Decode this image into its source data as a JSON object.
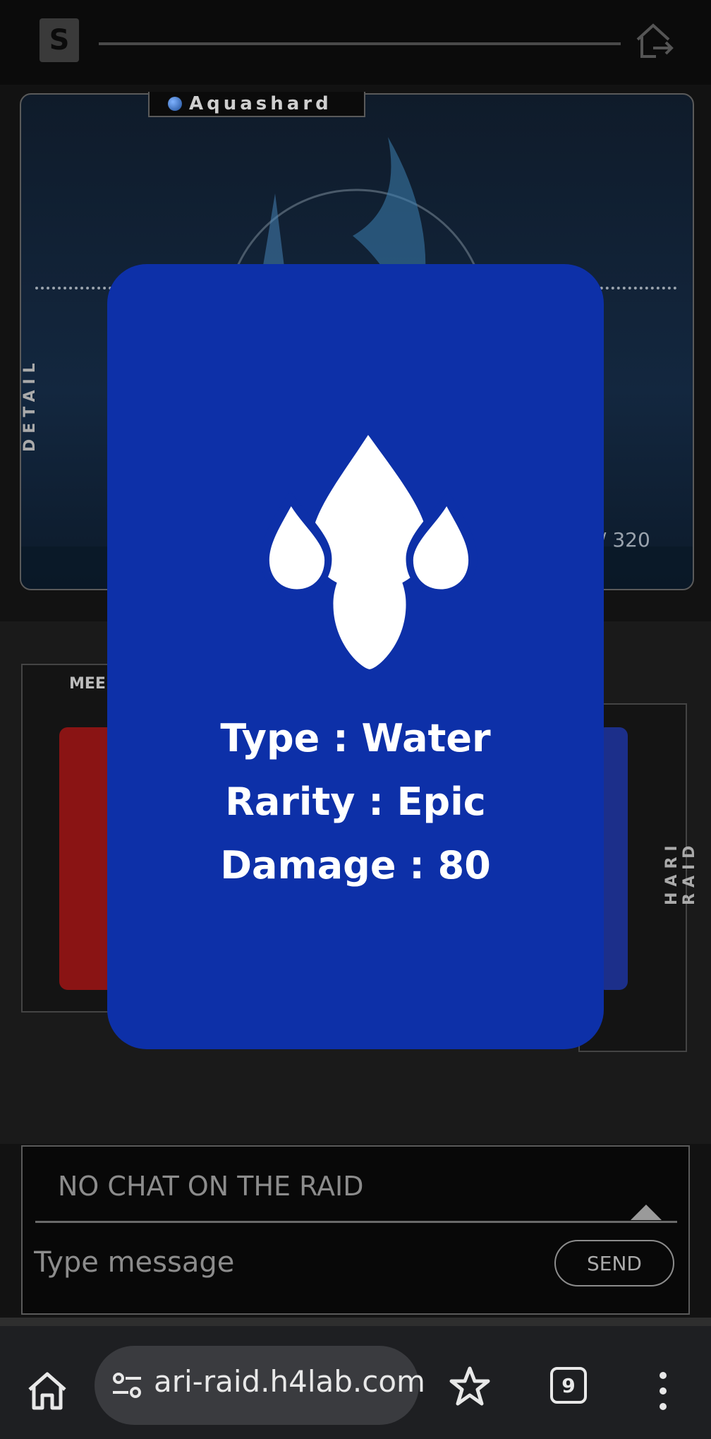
{
  "header": {
    "logo_glyph": "S"
  },
  "boss": {
    "name": "Aquashard",
    "hp_text": "/ 320",
    "side_label": "DETAIL"
  },
  "cards": {
    "left_label": "MEE",
    "right_side_label": "HARI RAID"
  },
  "modal": {
    "icon": "water-drops-icon",
    "type_text": "Type : Water",
    "rarity_text": "Rarity : Epic",
    "damage_text": "Damage : 80"
  },
  "chat": {
    "status": "NO CHAT ON THE RAID",
    "placeholder": "Type message",
    "send_label": "SEND"
  },
  "browser": {
    "url": "ari-raid.h4lab.com",
    "tab_count": "9"
  },
  "colors": {
    "modal_bg": "#0d30a8",
    "background": "#121212"
  }
}
